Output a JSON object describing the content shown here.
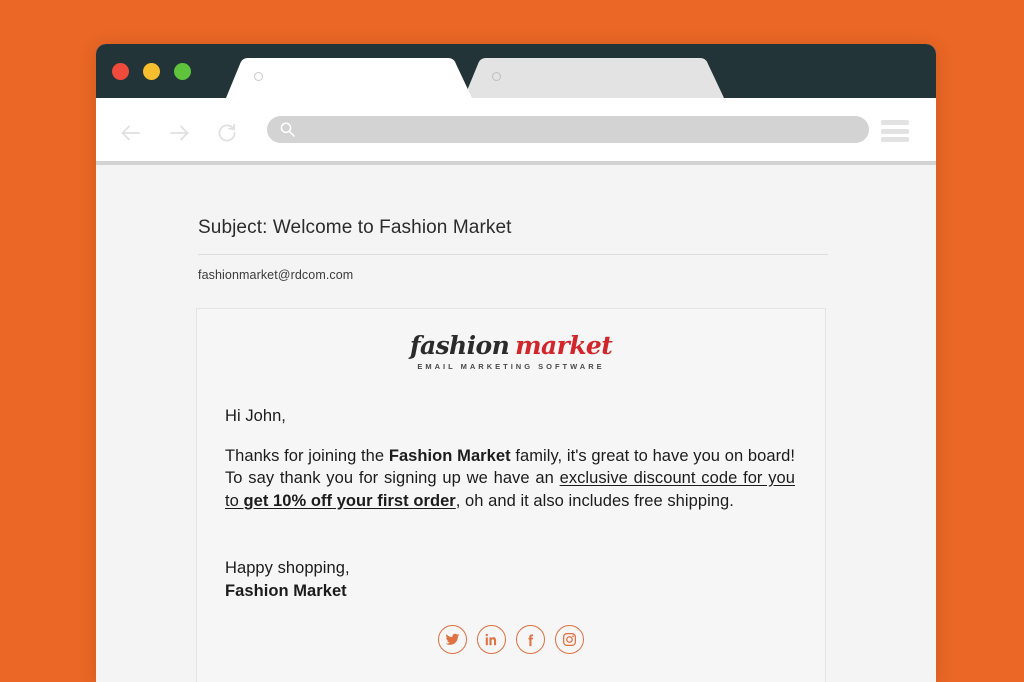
{
  "theme": {
    "page_background": "#EA6725",
    "titlebar": "#233439",
    "toolbar": "#FFFFFF",
    "content_background": "#F4F4F4",
    "card_background": "#F6F6F6",
    "accent_orange": "#E07142",
    "logo_red": "#D3262B",
    "logo_dark": "#2B2B2B"
  },
  "browser": {
    "traffic_lights": [
      {
        "name": "close",
        "color": "#F04A3C"
      },
      {
        "name": "minimize",
        "color": "#F5BE2E"
      },
      {
        "name": "maximize",
        "color": "#5FC33C"
      }
    ],
    "tabs": [
      {
        "label": "",
        "active": true
      },
      {
        "label": "",
        "active": false
      }
    ],
    "toolbar": {
      "back_icon": "arrow-left-icon",
      "forward_icon": "arrow-right-icon",
      "reload_icon": "reload-icon",
      "menu_icon": "hamburger-menu-icon",
      "address_value": "",
      "address_placeholder": "",
      "address_icon": "search-icon"
    }
  },
  "mail": {
    "subject": "Subject: Welcome to Fashion Market",
    "sender": "fashionmarket@rdcom.com",
    "logo": {
      "word_1": "fashion",
      "word_2": "market",
      "tagline": "EMAIL MARKETING SOFTWARE"
    },
    "body": {
      "greeting": "Hi John,",
      "paragraph": {
        "part_1": "Thanks for joining the ",
        "brand": "Fashion Market",
        "part_2": " family, it's great to have you on board! To say thank you for signing up we have an ",
        "link_text": "exclusive discount code for you to ",
        "offer": "get 10% off your first order",
        "part_3": ", oh and it also includes free shipping."
      },
      "closing_line": "Happy shopping,",
      "signature": "Fashion Market"
    },
    "socials": [
      {
        "name": "twitter",
        "glyph": "twitter-icon"
      },
      {
        "name": "linkedin",
        "glyph": "linkedin-icon"
      },
      {
        "name": "facebook",
        "glyph": "facebook-icon"
      },
      {
        "name": "instagram",
        "glyph": "instagram-icon"
      }
    ]
  }
}
